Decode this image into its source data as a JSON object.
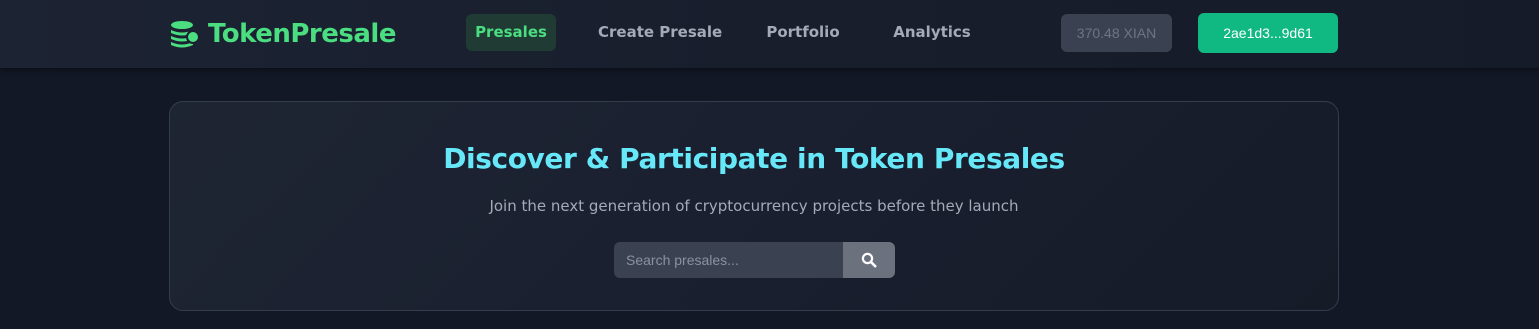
{
  "brand": {
    "name": "TokenPresale",
    "icon": "coins-stack-icon",
    "color": "#4ade80"
  },
  "nav": {
    "links": [
      {
        "label": "Presales",
        "active": true
      },
      {
        "label": "Create Presale",
        "active": false
      },
      {
        "label": "Portfolio",
        "active": false
      },
      {
        "label": "Analytics",
        "active": false
      }
    ],
    "balance": "370.48 XIAN",
    "wallet_address": "2ae1d3...9d61"
  },
  "hero": {
    "title": "Discover & Participate in Token Presales",
    "subtitle": "Join the next generation of cryptocurrency projects before they launch",
    "search": {
      "placeholder": "Search presales...",
      "value": "",
      "button_icon": "search-icon"
    }
  },
  "colors": {
    "accent_green": "#4ade80",
    "title_cyan": "#67e8f9",
    "wallet_button": "#10b981"
  }
}
